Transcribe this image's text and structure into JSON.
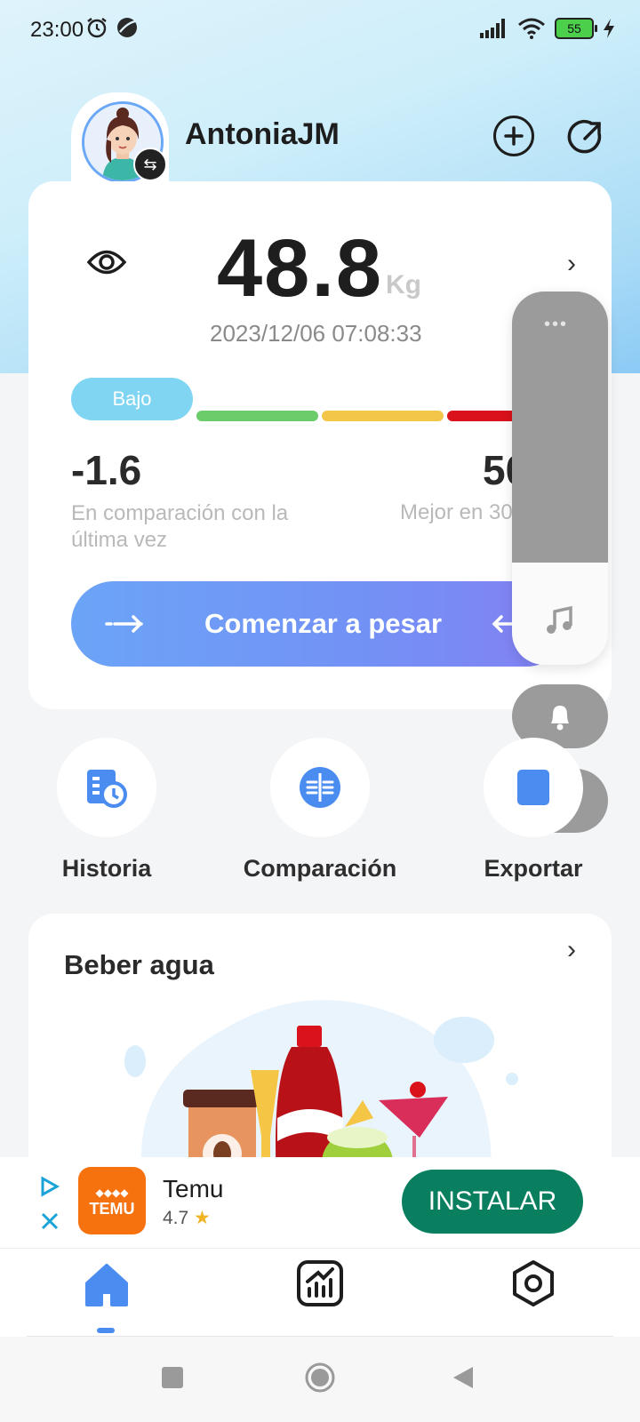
{
  "status_bar": {
    "time": "23:00",
    "battery": "55",
    "icons": [
      "alarm-icon",
      "vpn-icon",
      "signal-icon",
      "wifi-icon",
      "battery-icon",
      "charging-icon"
    ]
  },
  "header": {
    "username": "AntoniaJM",
    "buttons": [
      "add-icon",
      "refresh-icon"
    ]
  },
  "weight_card": {
    "weight": "48.8",
    "unit": "Kg",
    "datetime": "2023/12/06 07:08:33",
    "status_label": "Bajo",
    "bar_colors": [
      "#6acd6a",
      "#f3c64a",
      "#d9121b"
    ],
    "diff_value": "-1.6",
    "diff_label": "En comparación con la última vez",
    "best_value": "50",
    "best_label": "Mejor en 30",
    "start_button": "Comenzar a pesar"
  },
  "quick_actions": [
    {
      "label": "Historia",
      "icon": "history-icon"
    },
    {
      "label": "Comparación",
      "icon": "compare-icon"
    },
    {
      "label": "Exportar",
      "icon": "export-icon"
    }
  ],
  "water_card": {
    "title": "Beber agua"
  },
  "ad": {
    "app_name": "Temu",
    "rating": "4.7",
    "logo_text": "TEMU",
    "install_label": "INSTALAR"
  },
  "bottom_nav": [
    "home-icon",
    "stats-icon",
    "settings-icon"
  ],
  "colors": {
    "accent": "#4a8cf0",
    "install_green": "#0a7f60",
    "temu_orange": "#f5720f",
    "bajo_blue": "#7fd5f2"
  }
}
